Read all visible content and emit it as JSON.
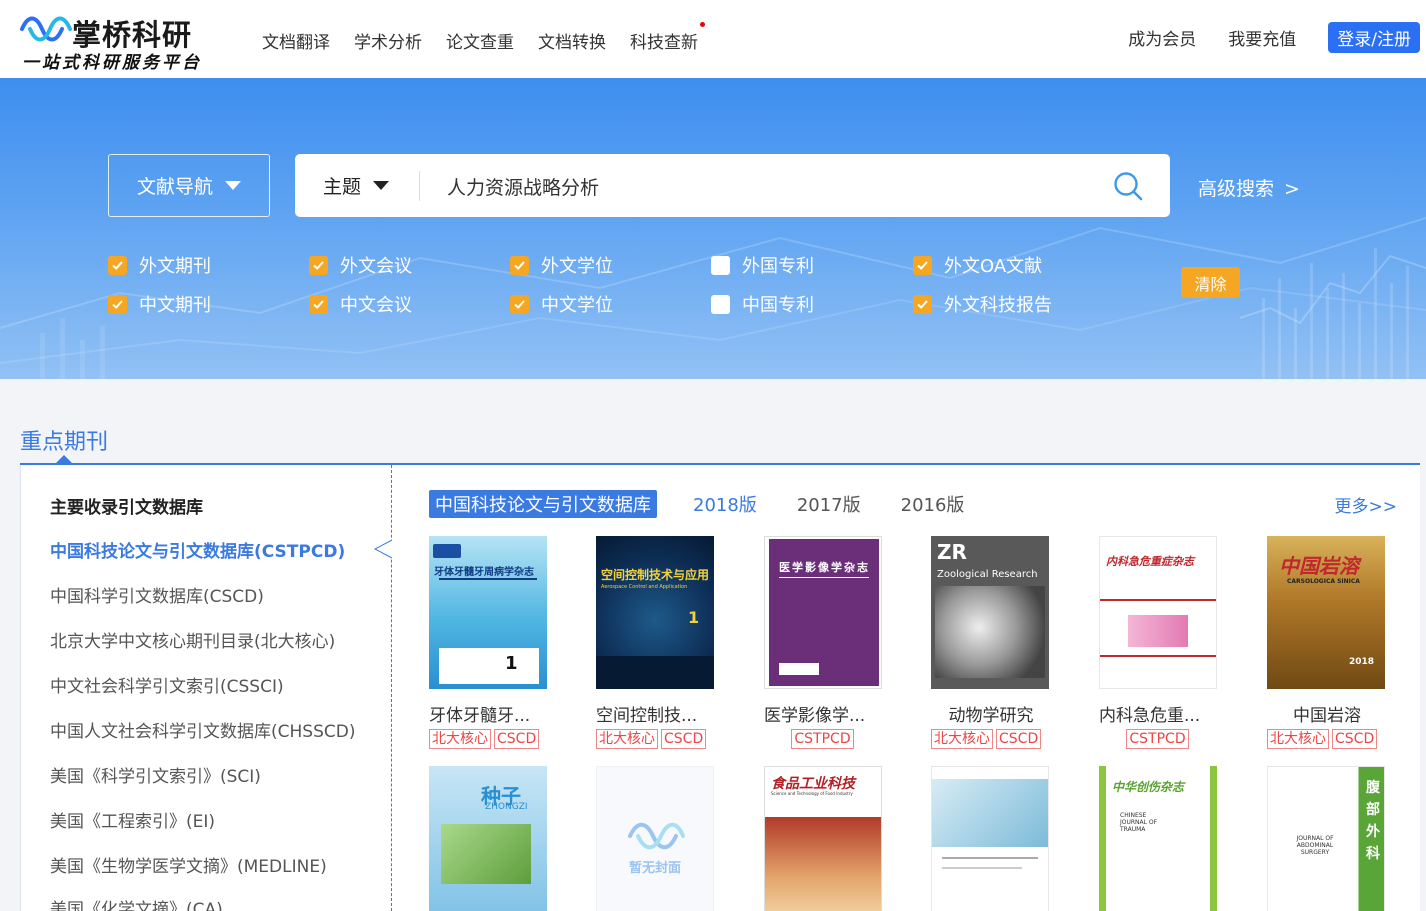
{
  "header": {
    "logo_title": "掌桥科研",
    "logo_slogan": "一站式科研服务平台",
    "nav": [
      "文档翻译",
      "学术分析",
      "论文查重",
      "文档转换",
      "科技查新"
    ],
    "links": [
      "成为会员",
      "我要充值"
    ],
    "login": "登录/注册"
  },
  "search": {
    "lib_nav": "文献导航",
    "field": "主题",
    "query": "人力资源战略分析",
    "advanced": "高级搜索",
    "advanced_arrow": ">",
    "clear": "清除",
    "checkboxes": [
      {
        "label": "外文期刊",
        "checked": true
      },
      {
        "label": "外文会议",
        "checked": true
      },
      {
        "label": "外文学位",
        "checked": true
      },
      {
        "label": "外国专利",
        "checked": false
      },
      {
        "label": "外文OA文献",
        "checked": true
      },
      {
        "label": "中文期刊",
        "checked": true
      },
      {
        "label": "中文会议",
        "checked": true
      },
      {
        "label": "中文学位",
        "checked": true
      },
      {
        "label": "中国专利",
        "checked": false
      },
      {
        "label": "外文科技报告",
        "checked": true
      }
    ]
  },
  "section": {
    "title": "重点期刊",
    "side_head": "主要收录引文数据库",
    "side_items": [
      "中国科技论文与引文数据库(CSTPCD)",
      "中国科学引文数据库(CSCD)",
      "北京大学中文核心期刊目录(北大核心)",
      "中文社会科学引文索引(CSSCI)",
      "中国人文社会科学引文数据库(CHSSCD)",
      "美国《科学引文索引》(SCI)",
      "美国《工程索引》(EI)",
      "美国《生物学医学文摘》(MEDLINE)",
      "美国《化学文摘》(CA)"
    ],
    "tabs": [
      "中国科技论文与引文数据库",
      "2018版",
      "2017版",
      "2016版"
    ],
    "more": "更多>>"
  },
  "journals": [
    {
      "name": "牙体牙髓牙...",
      "tags": [
        "北大核心",
        "CSCD"
      ],
      "cover_text": "牙体牙髓牙周病学杂志"
    },
    {
      "name": "空间控制技...",
      "tags": [
        "北大核心",
        "CSCD"
      ],
      "cover_text": "空间控制技术与应用",
      "cover_sub": "Aerospace Control and Application"
    },
    {
      "name": "医学影像学...",
      "tags": [
        "CSTPCD"
      ],
      "cover_text": "医学影像学杂志"
    },
    {
      "name": "动物学研究",
      "tags": [
        "北大核心",
        "CSCD"
      ],
      "cover_text": "ZR",
      "cover_sub": "Zoological Research"
    },
    {
      "name": "内科急危重...",
      "tags": [
        "CSTPCD"
      ],
      "cover_text": "内科急危重症杂志"
    },
    {
      "name": "中国岩溶",
      "tags": [
        "北大核心",
        "CSCD"
      ],
      "cover_text": "中国岩溶",
      "cover_sub": "CARSOLOGICA SINICA"
    }
  ],
  "journals_row2": [
    {
      "cover_text": "种子",
      "cover_sub": "ZHONGZI"
    },
    {
      "cover_text": "暂无封面"
    },
    {
      "cover_text": "食品工业科技",
      "cover_sub": "Science and Technology of Food Industry"
    },
    {
      "cover_text": ""
    },
    {
      "cover_text": "中华创伤杂志",
      "cover_sub": "CHINESE JOURNAL OF TRAUMA"
    },
    {
      "cover_text": "腹部外科",
      "cover_sub": "JOURNAL OF ABDOMINAL SURGERY"
    }
  ],
  "colors": {
    "brand_blue": "#2b6ff2",
    "accent_blue": "#3b7ae0",
    "orange": "#f5a623",
    "tag_red": "#e44444"
  }
}
